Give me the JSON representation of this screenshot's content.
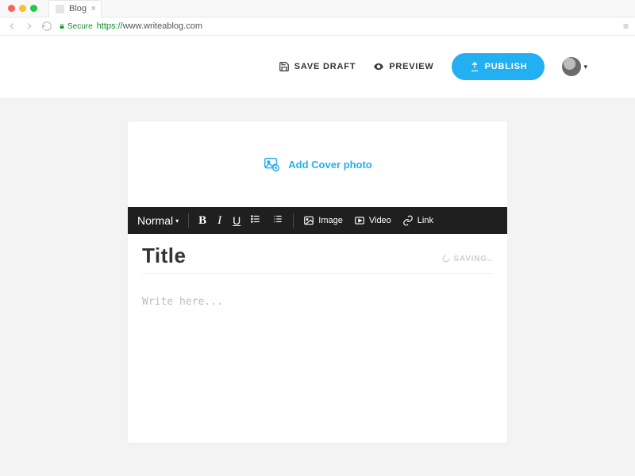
{
  "browser": {
    "tab_title": "Blog",
    "secure_label": "Secure",
    "url_https": "https://",
    "url_host": "www.writeablog.com"
  },
  "header": {
    "save_draft": "SAVE DRAFT",
    "preview": "PREVIEW",
    "publish": "PUBLISH"
  },
  "cover": {
    "label": "Add Cover photo"
  },
  "toolbar": {
    "format": "Normal",
    "bold": "B",
    "italic": "I",
    "underline": "U",
    "image": "Image",
    "video": "Video",
    "link": "Link"
  },
  "editor": {
    "title_placeholder": "Title",
    "body_placeholder": "Write here...",
    "saving": "SAVING.."
  },
  "colors": {
    "accent": "#22b0f2"
  }
}
